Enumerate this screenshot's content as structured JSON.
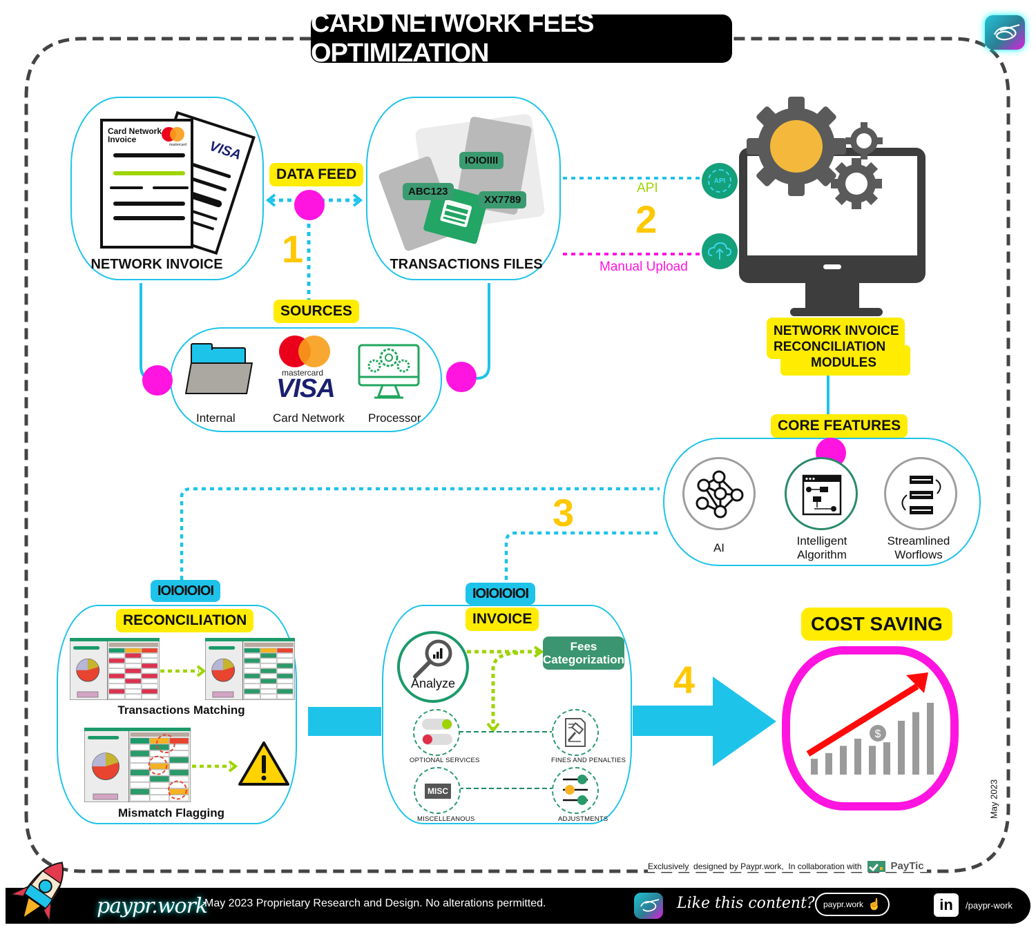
{
  "title": "CARD NETWORK FEES OPTIMIZATION",
  "colors": {
    "accent_cyan": "#1ec3ea",
    "accent_magenta": "#ff14e0",
    "accent_yellow": "#ffec00",
    "step_number": "#ffc800",
    "green": "#2a9a6a",
    "lime": "#9ed400",
    "dark_gray": "#3d3d3d"
  },
  "step1": {
    "number": "1",
    "data_feed_label": "DATA FEED",
    "network_invoice": {
      "label": "NETWORK INVOICE",
      "doc_title_line1": "Card Network",
      "doc_title_line2": "Invoice",
      "mastercard_text": "mastercard",
      "visa_text": "VISA"
    },
    "transactions_files": {
      "label": "TRANSACTIONS FILES",
      "tags": [
        "IOIOIIII",
        "ABC123",
        "XX7789"
      ]
    },
    "sources": {
      "label": "SOURCES",
      "items": [
        {
          "label": "Internal",
          "icon": "folder-icon"
        },
        {
          "label": "Card Network",
          "icon": "card-network-logos-icon",
          "mastercard_text": "mastercard",
          "visa_text": "VISA"
        },
        {
          "label": "Processor",
          "icon": "processor-gears-monitor-icon"
        }
      ]
    }
  },
  "step2": {
    "number": "2",
    "api_label": "API",
    "manual_upload_label": "Manual Upload",
    "api_icon": "api-gear-icon",
    "upload_icon": "cloud-upload-icon",
    "module_label_lines": [
      "NETWORK INVOICE",
      "RECONCILIATION",
      "MODULES"
    ]
  },
  "core_features": {
    "label": "CORE FEATURES",
    "items": [
      {
        "label_lines": [
          "AI"
        ],
        "icon": "neural-network-icon"
      },
      {
        "label_lines": [
          "Intelligent",
          "Algorithm"
        ],
        "icon": "algorithm-flowchart-icon"
      },
      {
        "label_lines": [
          "Streamlined",
          "Worflows"
        ],
        "icon": "workflow-icon"
      }
    ]
  },
  "step3": {
    "number": "3"
  },
  "reconciliation": {
    "binary_tag": "IOIOIOIOI",
    "label": "RECONCILIATION",
    "transactions_matching": "Transactions Matching",
    "mismatch_flagging": "Mismatch Flagging"
  },
  "invoice": {
    "binary_tag": "IOIOIOIOI",
    "label": "INVOICE",
    "analyze_label": "Analyze",
    "fees_categorization_lines": [
      "Fees",
      "Categorization"
    ],
    "categories": [
      {
        "label": "OPTIONAL SERVICES",
        "icon": "toggle-switches-icon"
      },
      {
        "label": "FINES AND PENALTIES",
        "icon": "gavel-document-icon"
      },
      {
        "label": "MISCELLEANOUS",
        "icon": "misc-box-icon",
        "icon_text": "MISC"
      },
      {
        "label": "ADJUSTMENTS",
        "icon": "sliders-icon"
      }
    ]
  },
  "step4": {
    "number": "4"
  },
  "cost_saving": {
    "label": "COST SAVING",
    "dollar_symbol": "$",
    "bar_relative_heights": [
      0.22,
      0.3,
      0.4,
      0.5,
      0.4,
      0.45,
      0.75,
      0.87,
      1.0
    ]
  },
  "side_date": "May 2023",
  "credit": {
    "text": "Exclusively  designed by Paypr.work,  In collaboration with",
    "partner": "PayTic"
  },
  "footer": {
    "brand": "paypr.work",
    "notice": "May 2023 Proprietary Research and Design. No alterations permitted.",
    "like_text": "Like this content?",
    "site_button": "paypr.work",
    "linkedin_icon_text": "in",
    "linkedin_handle": "/paypr-work"
  }
}
